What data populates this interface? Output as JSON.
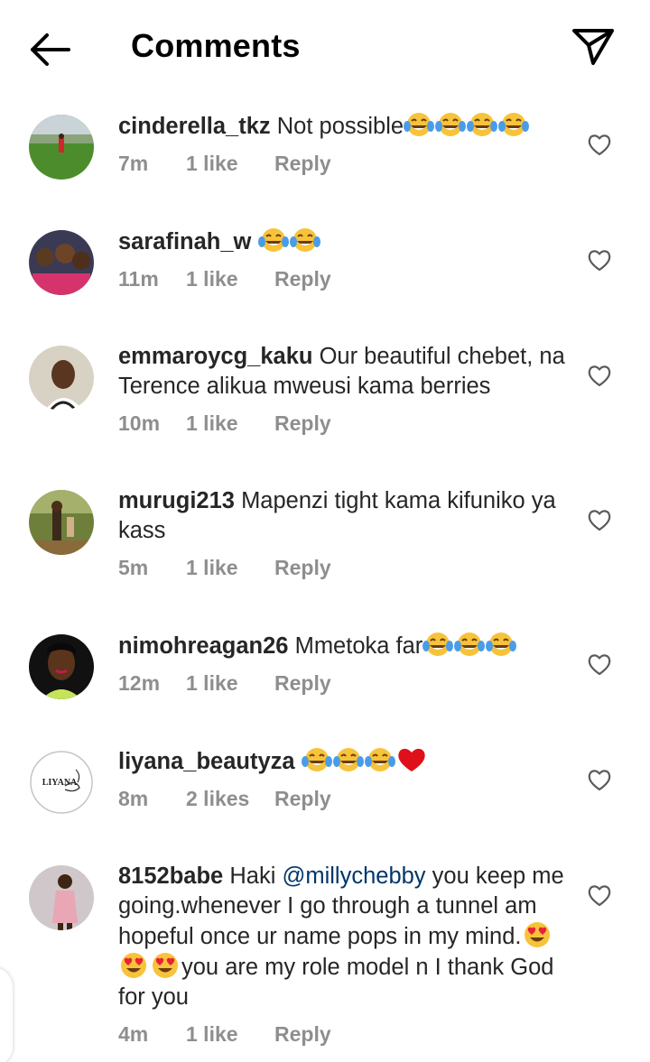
{
  "header": {
    "title": "Comments"
  },
  "comments": [
    {
      "username": "cinderella_tkz",
      "pre": "Not possible",
      "mention": "",
      "post": "",
      "emoji_mid": [],
      "tail": "",
      "emoji_end": [
        "joy",
        "joy",
        "joy",
        "joy"
      ],
      "time": "7m",
      "likes": "1 like",
      "reply": "Reply",
      "avatar": "field"
    },
    {
      "username": "sarafinah_w",
      "pre": "",
      "mention": "",
      "post": "",
      "emoji_mid": [],
      "tail": "",
      "emoji_end": [
        "joy",
        "joy"
      ],
      "time": "11m",
      "likes": "1 like",
      "reply": "Reply",
      "avatar": "group"
    },
    {
      "username": "emmaroycg_kaku",
      "pre": "Our beautiful chebet, na Terence alikua mweusi kama berries",
      "mention": "",
      "post": "",
      "emoji_mid": [],
      "tail": "",
      "emoji_end": [],
      "time": "10m",
      "likes": "1 like",
      "reply": "Reply",
      "avatar": "woman"
    },
    {
      "username": "murugi213",
      "pre": "Mapenzi tight kama kifuniko ya kass",
      "mention": "",
      "post": "",
      "emoji_mid": [],
      "tail": "",
      "emoji_end": [],
      "time": "5m",
      "likes": "1 like",
      "reply": "Reply",
      "avatar": "outdoor"
    },
    {
      "username": "nimohreagan26",
      "pre": "Mmetoka far",
      "mention": "",
      "post": "",
      "emoji_mid": [],
      "tail": "",
      "emoji_end": [
        "joy",
        "joy",
        "joy"
      ],
      "time": "12m",
      "likes": "1 like",
      "reply": "Reply",
      "avatar": "portrait"
    },
    {
      "username": "liyana_beautyza",
      "pre": "",
      "mention": "",
      "post": "",
      "emoji_mid": [],
      "tail": "",
      "emoji_end": [
        "joy",
        "joy",
        "joy",
        "heart"
      ],
      "time": "8m",
      "likes": "2 likes",
      "reply": "Reply",
      "avatar": "logo",
      "avatar_text": "LIYANA"
    },
    {
      "username": "8152babe",
      "pre": "Haki ",
      "mention": "@millychebby",
      "post": " you keep me going.whenever I go through a tunnel am hopeful once ur name pops in my mind.",
      "emoji_mid": [
        "hearteyes",
        "hearteyes",
        "hearteyes"
      ],
      "tail": "you are my role model n I thank God for you",
      "emoji_end": [],
      "time": "4m",
      "likes": "1 like",
      "reply": "Reply",
      "avatar": "pink"
    }
  ],
  "colors": {
    "text": "#262626",
    "meta": "#8e8e8e",
    "mention": "#00376b",
    "heart_red": "#e0101b"
  },
  "icons": {
    "back": "arrow-left-icon",
    "send": "paper-plane-icon",
    "like": "heart-outline-icon"
  }
}
